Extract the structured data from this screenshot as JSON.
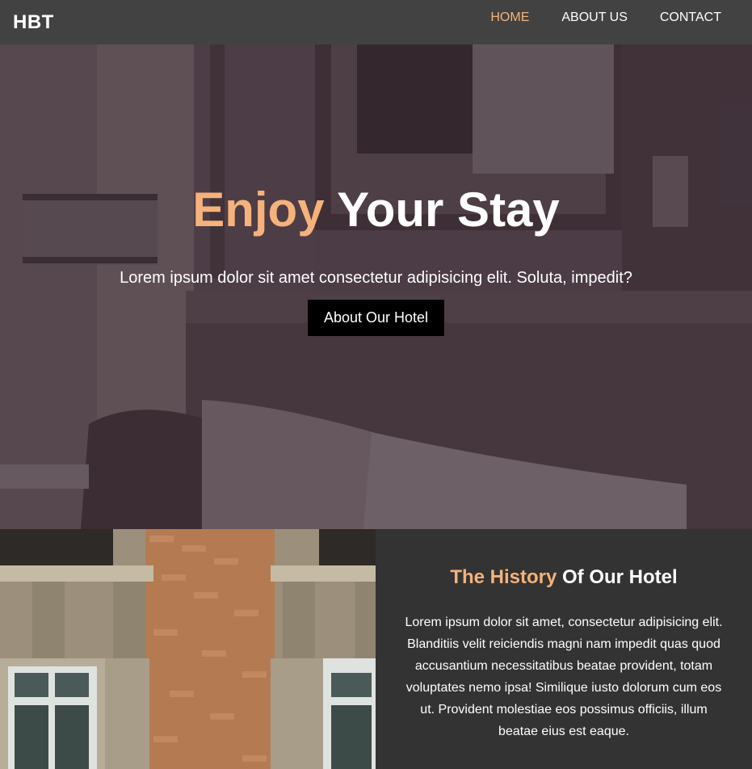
{
  "navbar": {
    "brand": "HBT",
    "links": [
      {
        "label": "HOME",
        "active": true
      },
      {
        "label": "ABOUT US",
        "active": false
      },
      {
        "label": "CONTACT",
        "active": false
      }
    ]
  },
  "hero": {
    "title_accent": "Enjoy",
    "title_rest": "Your Stay",
    "subtitle": "Lorem ipsum dolor sit amet consectetur adipisicing elit. Soluta, impedit?",
    "button_label": "About Our Hotel"
  },
  "history": {
    "title_accent": "The History",
    "title_rest": "Of Our Hotel",
    "body": "Lorem ipsum dolor sit amet, consectetur adipisicing elit. Blanditiis velit reiciendis magni nam impedit quas quod accusantium necessitatibus beatae provident, totam voluptates nemo ipsa! Similique iusto dolorum cum eos ut. Provident molestiae eos possimus officiis, illum beatae eius est eaque."
  },
  "colors": {
    "accent": "#f5b27a",
    "navbar_bg": "#424242",
    "section_bg": "#333333",
    "button_bg": "#000000"
  }
}
